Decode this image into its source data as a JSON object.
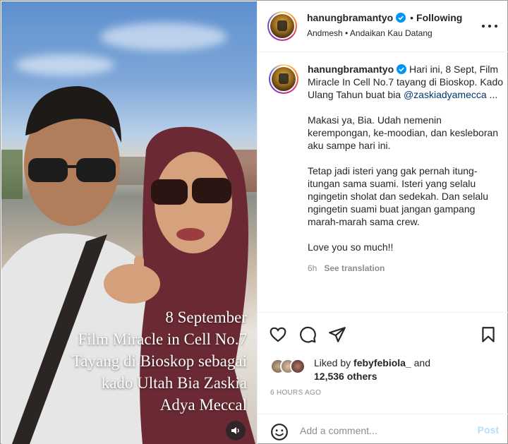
{
  "colors": {
    "text": "#262626",
    "muted": "#8e8e8e",
    "link": "#00376b",
    "verified": "#0095f6",
    "post_disabled": "#b2dffc",
    "border": "#efefef"
  },
  "media": {
    "overlay_lines": [
      "8 September",
      "Film Miracle in Cell No.7",
      "Tayang di Bioskop sebagai",
      "kado Ultah Bia Zaskia",
      "Adya Meccal"
    ],
    "sound_icon": "speaker-icon"
  },
  "header": {
    "username": "hanungbramantyo",
    "follow_status": "Following",
    "separator": "•",
    "audio_artist": "Andmesh",
    "audio_separator": "•",
    "audio_title": "Andaikan Kau Datang",
    "more_icon": "more-dots-icon"
  },
  "caption": {
    "username": "hanungbramantyo",
    "paragraph1": "Hari ini, 8 Sept, Film Miracle In Cell No.7 tayang di Bioskop. Kado Ulang Tahun buat bia",
    "mention": "@zaskiadyamecca",
    "ellipsis": " ...",
    "paragraph2": "Makasi ya, Bia. Udah nemenin kerempongan, ke-moodian, dan kesleboran aku sampe hari ini.",
    "paragraph3": "Tetap jadi isteri yang gak pernah itung-itungan sama suami. Isteri yang selalu ngingetin sholat dan sedekah. Dan selalu ngingetin suami buat jangan gampang marah-marah sama crew.",
    "paragraph4": "Love you so much!!",
    "age": "6h",
    "see_translation": "See translation"
  },
  "actions": {
    "like_icon": "heart-icon",
    "comment_icon": "comment-bubble-icon",
    "share_icon": "paper-plane-icon",
    "save_icon": "bookmark-icon"
  },
  "likes": {
    "prefix": "Liked by",
    "user": "febyfebiola_",
    "and": "and",
    "others": "12,536 others"
  },
  "timestamp": "6 HOURS AGO",
  "add_comment": {
    "emoji_icon": "smiley-icon",
    "placeholder": "Add a comment...",
    "post_label": "Post"
  }
}
